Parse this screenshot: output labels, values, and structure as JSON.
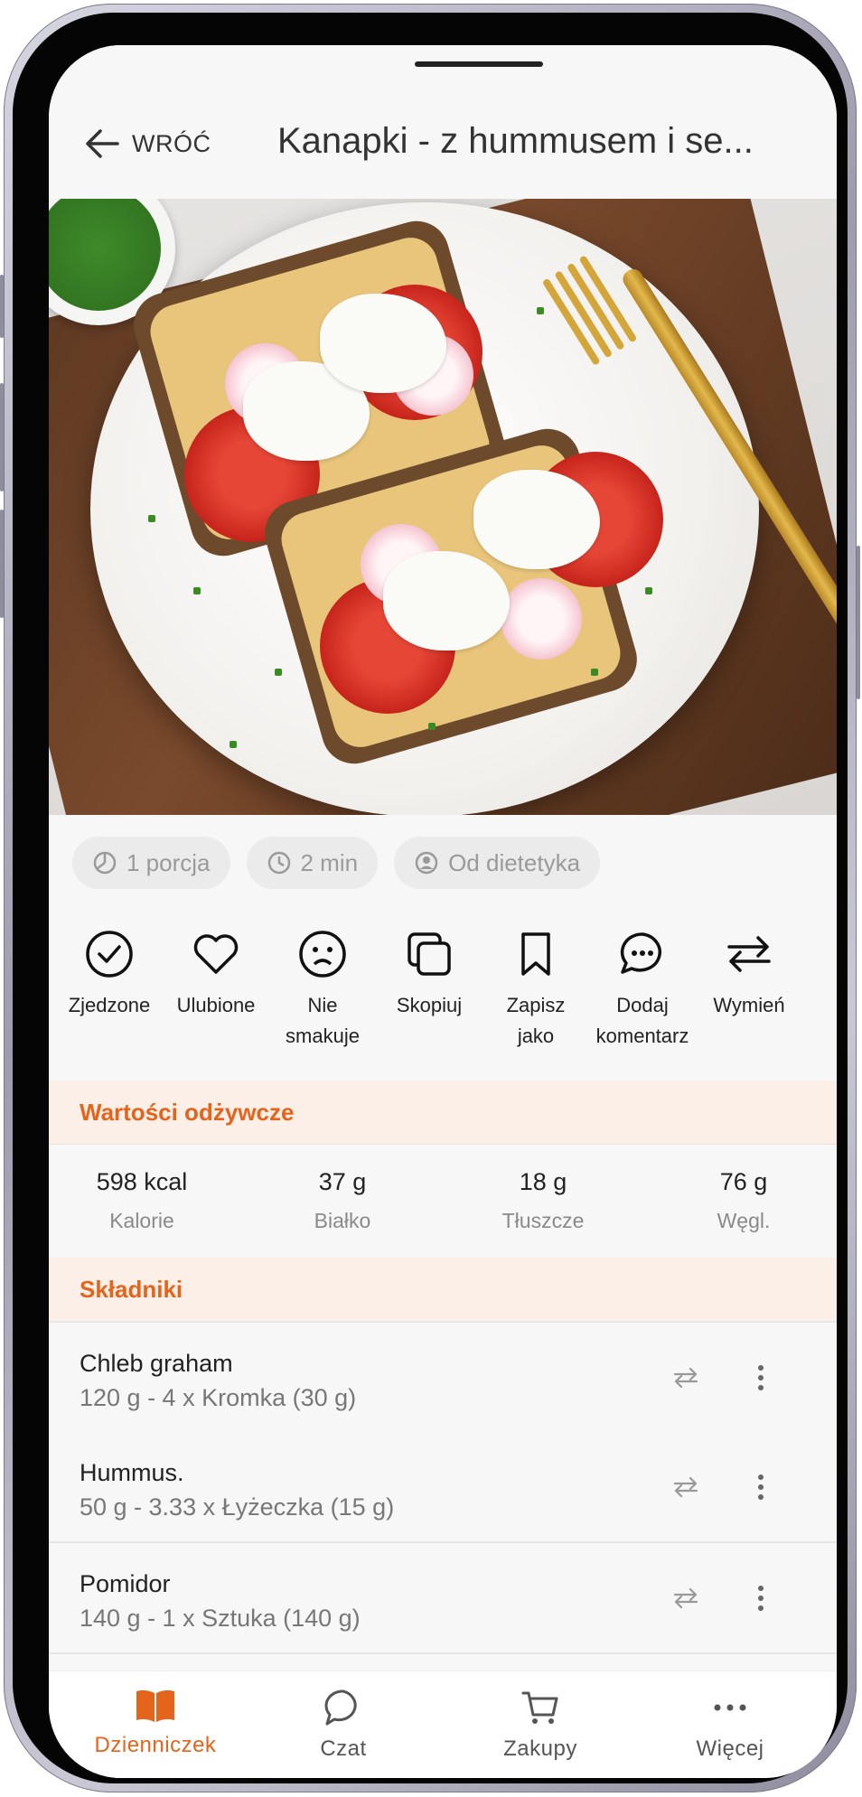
{
  "header": {
    "back_label": "WRÓĆ",
    "title": "Kanapki - z hummusem i se..."
  },
  "chips": [
    {
      "icon": "pie-icon",
      "label": "1 porcja"
    },
    {
      "icon": "clock-icon",
      "label": "2 min"
    },
    {
      "icon": "person-icon",
      "label": "Od dietetyka"
    }
  ],
  "actions": [
    {
      "icon": "check-circle-icon",
      "label": "Zjedzone"
    },
    {
      "icon": "heart-icon",
      "label": "Ulubione"
    },
    {
      "icon": "sad-face-icon",
      "label": "Nie smakuje"
    },
    {
      "icon": "copy-icon",
      "label": "Skopiuj"
    },
    {
      "icon": "bookmark-icon",
      "label": "Zapisz jako"
    },
    {
      "icon": "comment-icon",
      "label": "Dodaj komentarz"
    },
    {
      "icon": "swap-icon",
      "label": "Wymień"
    }
  ],
  "nutrition": {
    "heading": "Wartości odżywcze",
    "items": [
      {
        "value": "598 kcal",
        "label": "Kalorie"
      },
      {
        "value": "37 g",
        "label": "Białko"
      },
      {
        "value": "18 g",
        "label": "Tłuszcze"
      },
      {
        "value": "76 g",
        "label": "Węgl."
      }
    ]
  },
  "ingredients": {
    "heading": "Składniki",
    "items": [
      {
        "name": "Chleb graham",
        "quantity": "120 g - 4 x Kromka (30 g)"
      },
      {
        "name": "Hummus.",
        "quantity": "50 g - 3.33 x Łyżeczka (15 g)"
      },
      {
        "name": "Pomidor",
        "quantity": "140 g - 1 x Sztuka (140 g)"
      }
    ]
  },
  "nav": [
    {
      "icon": "book-icon",
      "label": "Dzienniczek",
      "active": true
    },
    {
      "icon": "chat-icon",
      "label": "Czat"
    },
    {
      "icon": "cart-icon",
      "label": "Zakupy"
    },
    {
      "icon": "more-dots-icon",
      "label": "Więcej"
    }
  ],
  "colors": {
    "accent": "#e4641c",
    "section_bg": "#fcefe8",
    "background": "#f7f7f7"
  }
}
